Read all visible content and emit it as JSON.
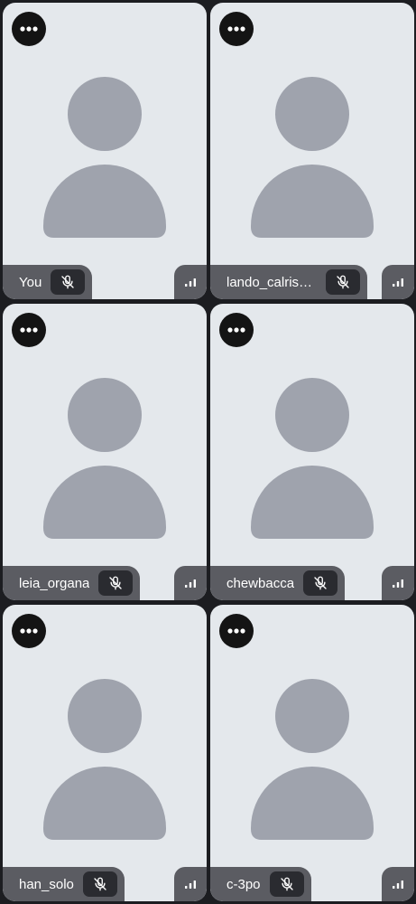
{
  "theme": {
    "background": "#1c1d21",
    "tile_bg": "#e4e8ec",
    "avatar_color": "#9fa3ad",
    "bar_bg": "#5b5c62",
    "mute_bg": "#2a2b30",
    "more_bg": "#141414"
  },
  "participants": [
    {
      "name": "You",
      "mic_icon": "mic-off-icon",
      "more_icon": "more-horizontal-icon",
      "signal_icon": "signal-bars-icon"
    },
    {
      "name": "lando_calrissian",
      "mic_icon": "mic-off-icon",
      "more_icon": "more-horizontal-icon",
      "signal_icon": "signal-bars-icon"
    },
    {
      "name": "leia_organa",
      "mic_icon": "mic-off-icon",
      "more_icon": "more-horizontal-icon",
      "signal_icon": "signal-bars-icon"
    },
    {
      "name": "chewbacca",
      "mic_icon": "mic-off-icon",
      "more_icon": "more-horizontal-icon",
      "signal_icon": "signal-bars-icon"
    },
    {
      "name": "han_solo",
      "mic_icon": "mic-off-icon",
      "more_icon": "more-horizontal-icon",
      "signal_icon": "signal-bars-icon"
    },
    {
      "name": "c-3po",
      "mic_icon": "mic-off-icon",
      "more_icon": "more-horizontal-icon",
      "signal_icon": "signal-bars-icon"
    }
  ]
}
